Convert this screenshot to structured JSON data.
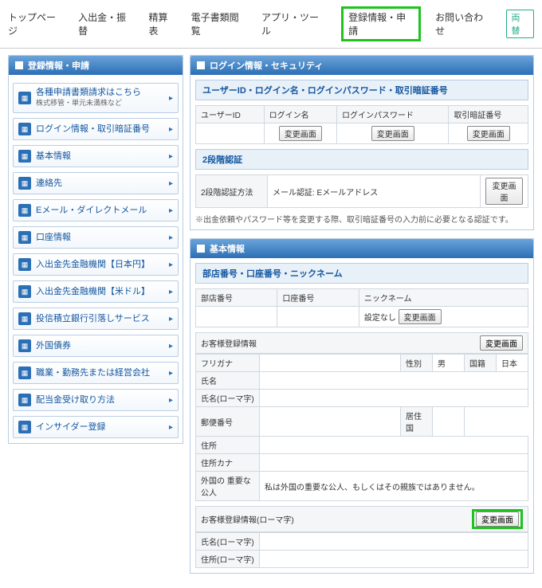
{
  "nav": {
    "items": [
      "トップページ",
      "入出金・振替",
      "精算表",
      "電子書類閲覧",
      "アプリ・ツール",
      "登録情報・申請",
      "お問い合わせ"
    ],
    "highlight_index": 5,
    "ryogae": "両替"
  },
  "sidebar": {
    "title": "登録情報・申請",
    "items": [
      {
        "label": "各種申請書類請求はこちら",
        "sub": "株式移管・単元未満株など"
      },
      {
        "label": "ログイン情報・取引暗証番号"
      },
      {
        "label": "基本情報"
      },
      {
        "label": "連絡先"
      },
      {
        "label": "Eメール・ダイレクトメール"
      },
      {
        "label": "口座情報"
      },
      {
        "label": "入出金先金融機関【日本円】"
      },
      {
        "label": "入出金先金融機関【米ドル】"
      },
      {
        "label": "投信積立銀行引落しサービス"
      },
      {
        "label": "外国債券"
      },
      {
        "label": "職業・勤務先または経営会社"
      },
      {
        "label": "配当金受け取り方法"
      },
      {
        "label": "インサイダー登録"
      }
    ]
  },
  "main": {
    "login": {
      "title": "ログイン情報・セキュリティ",
      "sub1": "ユーザーID・ログイン名・ログインパスワード・取引暗証番号",
      "cols": [
        "ユーザーID",
        "ログイン名",
        "ログインパスワード",
        "取引暗証番号"
      ],
      "btn": "変更画面",
      "sub2": "2段階認証",
      "twofa_label": "2段階認証方法",
      "twofa_val": "メール認証: Eメールアドレス",
      "note": "※出金依頼やパスワード等を変更する際、取引暗証番号の入力前に必要となる認証です。"
    },
    "basic": {
      "title": "基本情報",
      "sub1": "部店番号・口座番号・ニックネーム",
      "cols1": [
        "部店番号",
        "口座番号",
        "ニックネーム"
      ],
      "nickname_val": "設定なし",
      "btn": "変更画面",
      "sub2": "お客様登録情報",
      "rows2": [
        {
          "k": "フリガナ",
          "extra": [
            "性別",
            "男",
            "国籍",
            "日本"
          ]
        },
        {
          "k": "氏名"
        },
        {
          "k": "氏名(ローマ字)"
        },
        {
          "k": "郵便番号",
          "extra": [
            "居住国",
            ""
          ]
        },
        {
          "k": "住所"
        },
        {
          "k": "住所カナ"
        },
        {
          "k": "外国の\n重要な公人",
          "v": "私は外国の重要な公人、もしくはその親族ではありません。"
        }
      ],
      "sub3": "お客様登録情報(ローマ字)",
      "rows3": [
        "氏名(ローマ字)",
        "住所(ローマ字)"
      ]
    }
  }
}
